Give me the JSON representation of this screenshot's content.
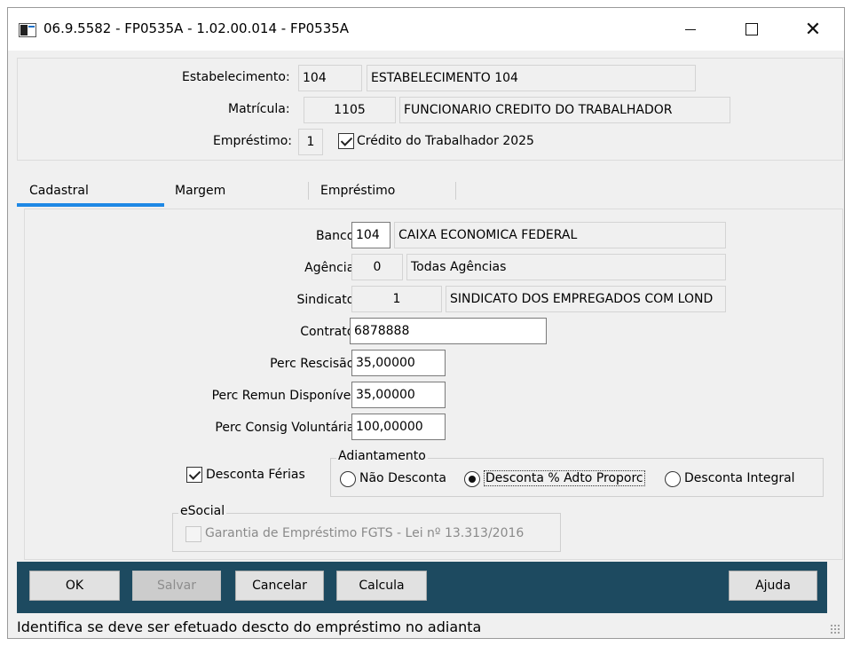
{
  "window": {
    "title": "06.9.5582 - FP0535A - 1.02.00.014 - FP0535A",
    "icon": "app-window-icon",
    "close_glyph": "✕"
  },
  "header": {
    "estabelecimento_label": "Estabelecimento:",
    "estabelecimento_code": "104",
    "estabelecimento_name": "ESTABELECIMENTO 104",
    "matricula_label": "Matrícula:",
    "matricula_code": "1105",
    "matricula_name": "FUNCIONARIO CREDITO  DO TRABALHADOR",
    "emprestimo_label": "Empréstimo:",
    "emprestimo_value": "1",
    "credito_label": "Crédito do Trabalhador 2025",
    "credito_checked": true
  },
  "tabs": [
    {
      "label": "Cadastral",
      "active": true
    },
    {
      "label": "Margem",
      "active": false
    },
    {
      "label": "Empréstimo",
      "active": false
    }
  ],
  "form": {
    "banco_label": "Banco:",
    "banco_code": "104",
    "banco_name": "CAIXA ECONOMICA FEDERAL",
    "agencia_label": "Agência:",
    "agencia_code": "0",
    "agencia_name": "Todas Agências",
    "sindicato_label": "Sindicato:",
    "sindicato_code": "1",
    "sindicato_name": "SINDICATO DOS EMPREGADOS COM LOND",
    "contrato_label": "Contrato:",
    "contrato_value": "6878888",
    "perc_rescisao_label": "Perc Rescisão:",
    "perc_rescisao_value": "35,00000",
    "perc_remun_label": "Perc Remun Disponível:",
    "perc_remun_value": "35,00000",
    "perc_consig_label": "Perc Consig Voluntária:",
    "perc_consig_value": "100,00000",
    "desconta_ferias_label": "Desconta Férias",
    "desconta_ferias_checked": true,
    "adiantamento": {
      "title": "Adiantamento",
      "options": [
        {
          "label": "Não Desconta",
          "selected": false
        },
        {
          "label": "Desconta % Adto Proporc",
          "selected": true
        },
        {
          "label": "Desconta Integral",
          "selected": false
        }
      ]
    },
    "esocial": {
      "title": "eSocial",
      "garantia_label": "Garantia de Empréstimo FGTS - Lei nº 13.313/2016",
      "garantia_checked": false
    }
  },
  "buttons": {
    "ok": "OK",
    "salvar": "Salvar",
    "cancelar": "Cancelar",
    "calcula": "Calcula",
    "ajuda": "Ajuda"
  },
  "status": {
    "text": "Identifica se deve ser efetuado descto do empréstimo no adianta"
  },
  "colors": {
    "tab_accent": "#1e88e5",
    "button_bar": "#1d4a60"
  }
}
